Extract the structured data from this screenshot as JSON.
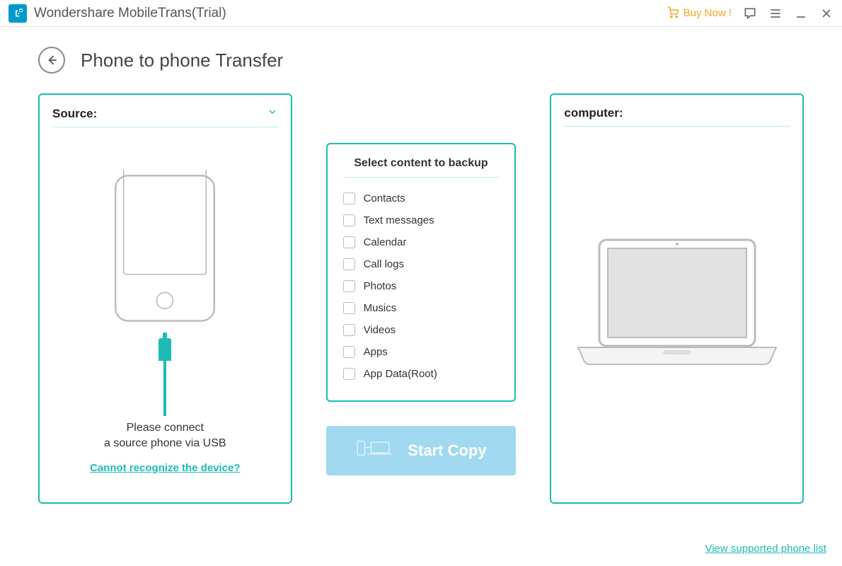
{
  "titlebar": {
    "app_name": "Wondershare MobileTrans(Trial)",
    "buy_now": "Buy Now !"
  },
  "header": {
    "title": "Phone to phone Transfer"
  },
  "source_panel": {
    "label": "Source:",
    "connect_line1": "Please connect",
    "connect_line2": "a source phone via USB",
    "recognize_link": "Cannot recognize the device?"
  },
  "content_box": {
    "title": "Select content to backup",
    "items": [
      "Contacts",
      "Text messages",
      "Calendar",
      "Call logs",
      "Photos",
      "Musics",
      "Videos",
      "Apps",
      "App Data(Root)"
    ]
  },
  "start_button": "Start Copy",
  "dest_panel": {
    "label": "computer:"
  },
  "footer": {
    "supported_link": "View supported phone list"
  }
}
